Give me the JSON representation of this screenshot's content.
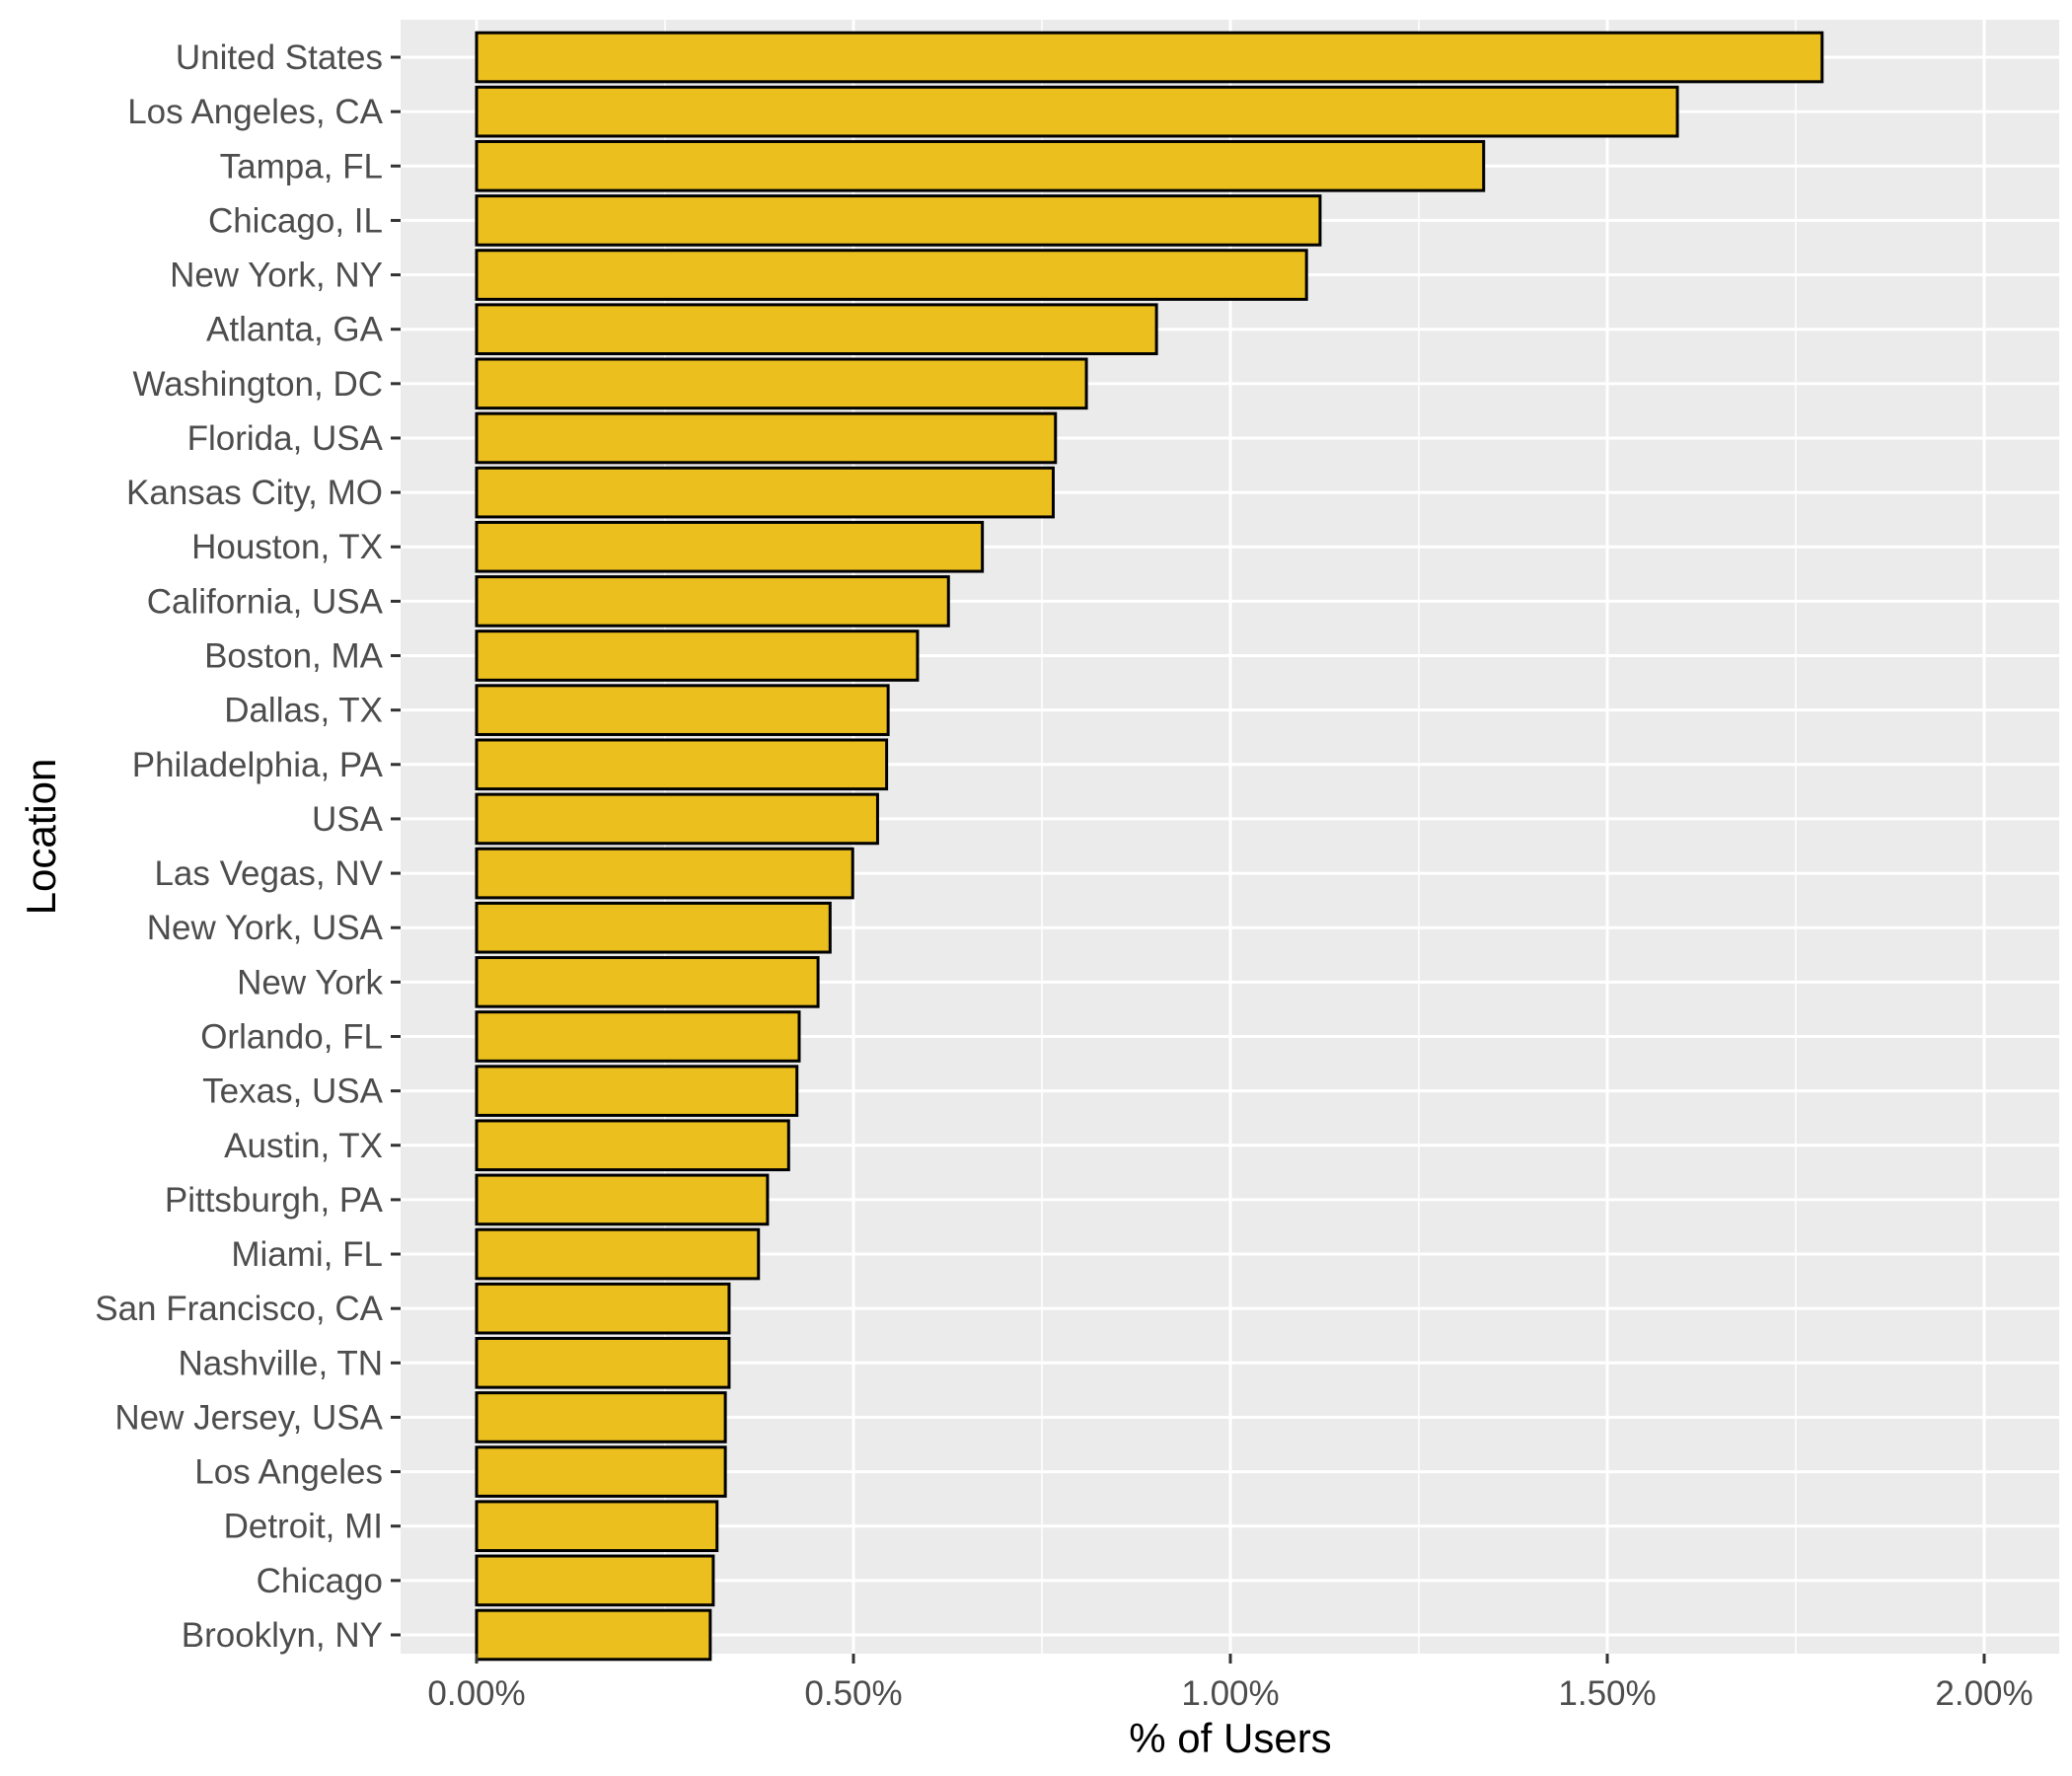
{
  "chart_data": {
    "type": "bar",
    "orientation": "horizontal",
    "title": "",
    "xlabel": "% of Users",
    "ylabel": "Location",
    "xlim": [
      0,
      2.1
    ],
    "x_ticks": [
      0,
      0.5,
      1.0,
      1.5,
      2.0
    ],
    "x_tick_labels": [
      "0.00%",
      "0.50%",
      "1.00%",
      "1.50%",
      "2.00%"
    ],
    "grid": true,
    "legend": "none",
    "bar_fill": "#EBBF1D",
    "bar_outline": "#000000",
    "panel_background": "#EBEBEB",
    "categories": [
      "United States",
      "Los Angeles, CA",
      "Tampa, FL",
      "Chicago, IL",
      "New York, NY",
      "Atlanta, GA",
      "Washington, DC",
      "Florida, USA",
      "Kansas City, MO",
      "Houston, TX",
      "California, USA",
      "Boston, MA",
      "Dallas, TX",
      "Philadelphia, PA",
      "USA",
      "Las Vegas, NV",
      "New York, USA",
      "New York",
      "Orlando, FL",
      "Texas, USA",
      "Austin, TX",
      "Pittsburgh, PA",
      "Miami, FL",
      "San Francisco, CA",
      "Nashville, TN",
      "New Jersey, USA",
      "Los Angeles",
      "Detroit, MI",
      "Chicago",
      "Brooklyn, NY"
    ],
    "values": [
      1.785,
      1.593,
      1.336,
      1.119,
      1.101,
      0.902,
      0.809,
      0.768,
      0.765,
      0.671,
      0.626,
      0.585,
      0.546,
      0.544,
      0.532,
      0.499,
      0.469,
      0.453,
      0.428,
      0.425,
      0.414,
      0.386,
      0.374,
      0.335,
      0.335,
      0.33,
      0.33,
      0.319,
      0.314,
      0.31
    ],
    "value_unit": "%"
  }
}
